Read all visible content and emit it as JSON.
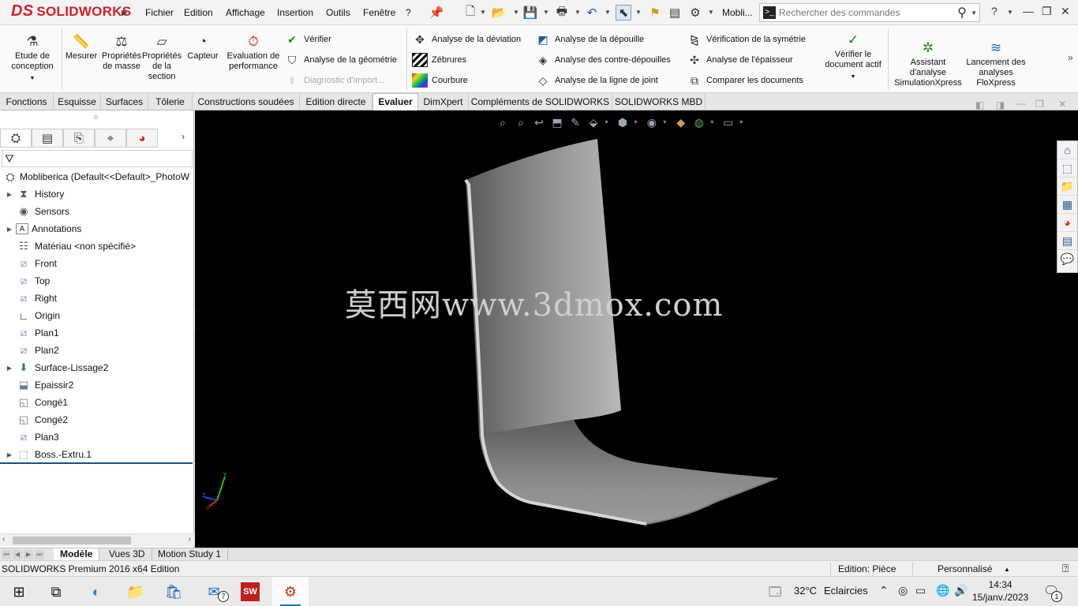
{
  "app": {
    "logo_text": "SOLIDWORKS",
    "menu": [
      "Fichier",
      "Edition",
      "Affichage",
      "Insertion",
      "Outils",
      "Fenêtre",
      "?"
    ],
    "doc_short": "Mobli...",
    "search_placeholder": "Rechercher des commandes",
    "help_label": "?"
  },
  "ribbon": {
    "big_buttons": [
      {
        "label": "Etude de conception",
        "icon": "design-study-icon"
      },
      {
        "label": "Mesurer",
        "icon": "measure-icon"
      },
      {
        "label": "Propriétés de masse",
        "icon": "mass-properties-icon"
      },
      {
        "label": "Propriétés de la section",
        "icon": "section-properties-icon"
      },
      {
        "label": "Capteur",
        "icon": "sensor-icon"
      },
      {
        "label": "Evaluation de performance",
        "icon": "performance-icon"
      }
    ],
    "col1": [
      {
        "label": "Vérifier",
        "disabled": false
      },
      {
        "label": "Analyse de la géométrie",
        "disabled": false
      },
      {
        "label": "Diagnostic d'import...",
        "disabled": true
      }
    ],
    "col2": [
      {
        "label": "Analyse de la déviation"
      },
      {
        "label": "Zébrures"
      },
      {
        "label": "Courbure"
      }
    ],
    "col3": [
      {
        "label": "Analyse de la dépouille"
      },
      {
        "label": "Analyse des contre-dépouilles"
      },
      {
        "label": "Analyse de la ligne de joint"
      }
    ],
    "col4": [
      {
        "label": "Vérification de la symétrie"
      },
      {
        "label": "Analyse de l'épaisseur"
      },
      {
        "label": "Comparer les documents"
      }
    ],
    "right_buttons": [
      {
        "label": "Vérifier le document actif"
      },
      {
        "label": "Assistant d'analyse SimulationXpress"
      },
      {
        "label": "Lancement des analyses FloXpress"
      }
    ]
  },
  "tabs": [
    {
      "label": "Fonctions",
      "active": false
    },
    {
      "label": "Esquisse",
      "active": false
    },
    {
      "label": "Surfaces",
      "active": false
    },
    {
      "label": "Tôlerie",
      "active": false
    },
    {
      "label": "Constructions soudées",
      "active": false
    },
    {
      "label": "Edition directe",
      "active": false
    },
    {
      "label": "Evaluer",
      "active": true
    },
    {
      "label": "DimXpert",
      "active": false
    },
    {
      "label": "Compléments de SOLIDWORKS",
      "active": false
    },
    {
      "label": "SOLIDWORKS MBD",
      "active": false
    }
  ],
  "tree": {
    "root": "Mobliberica  (Default<<Default>_PhotoW",
    "items": [
      {
        "label": "History",
        "icon": "history-icon",
        "expandable": true
      },
      {
        "label": "Sensors",
        "icon": "sensors-icon",
        "expandable": false
      },
      {
        "label": "Annotations",
        "icon": "annotations-icon",
        "expandable": true
      },
      {
        "label": "Matériau <non spécifié>",
        "icon": "material-icon",
        "expandable": false
      },
      {
        "label": "Front",
        "icon": "plane-icon",
        "expandable": false
      },
      {
        "label": "Top",
        "icon": "plane-icon",
        "expandable": false
      },
      {
        "label": "Right",
        "icon": "plane-icon",
        "expandable": false
      },
      {
        "label": "Origin",
        "icon": "origin-icon",
        "expandable": false
      },
      {
        "label": "Plan1",
        "icon": "plane-icon",
        "expandable": false
      },
      {
        "label": "Plan2",
        "icon": "plane-icon",
        "expandable": false
      },
      {
        "label": "Surface-Lissage2",
        "icon": "loft-surface-icon",
        "expandable": true
      },
      {
        "label": "Epaissir2",
        "icon": "thicken-icon",
        "expandable": false
      },
      {
        "label": "Congé1",
        "icon": "fillet-icon",
        "expandable": false
      },
      {
        "label": "Congé2",
        "icon": "fillet-icon",
        "expandable": false
      },
      {
        "label": "Plan3",
        "icon": "plane-icon",
        "expandable": false
      },
      {
        "label": "Boss.-Extru.1",
        "icon": "extrude-icon",
        "expandable": true
      }
    ]
  },
  "viewport": {
    "watermark": "莫西网www.3dmox.com"
  },
  "bottom_tabs": [
    {
      "label": "Modèle",
      "active": true
    },
    {
      "label": "Vues 3D",
      "active": false
    },
    {
      "label": "Motion Study 1",
      "active": false
    }
  ],
  "status": {
    "edition": "SOLIDWORKS Premium 2016 x64 Edition",
    "mode": "Edition: Pièce",
    "custom": "Personnalisé"
  },
  "taskbar": {
    "mail_badge": "7",
    "temperature": "32°C",
    "weather": "Eclaircies",
    "time": "14:34",
    "date": "15/janv./2023",
    "notif_count": "1"
  },
  "colors": {
    "brand": "#d0202a",
    "viewport_bg": "#000000",
    "accent": "#1a73c8"
  }
}
